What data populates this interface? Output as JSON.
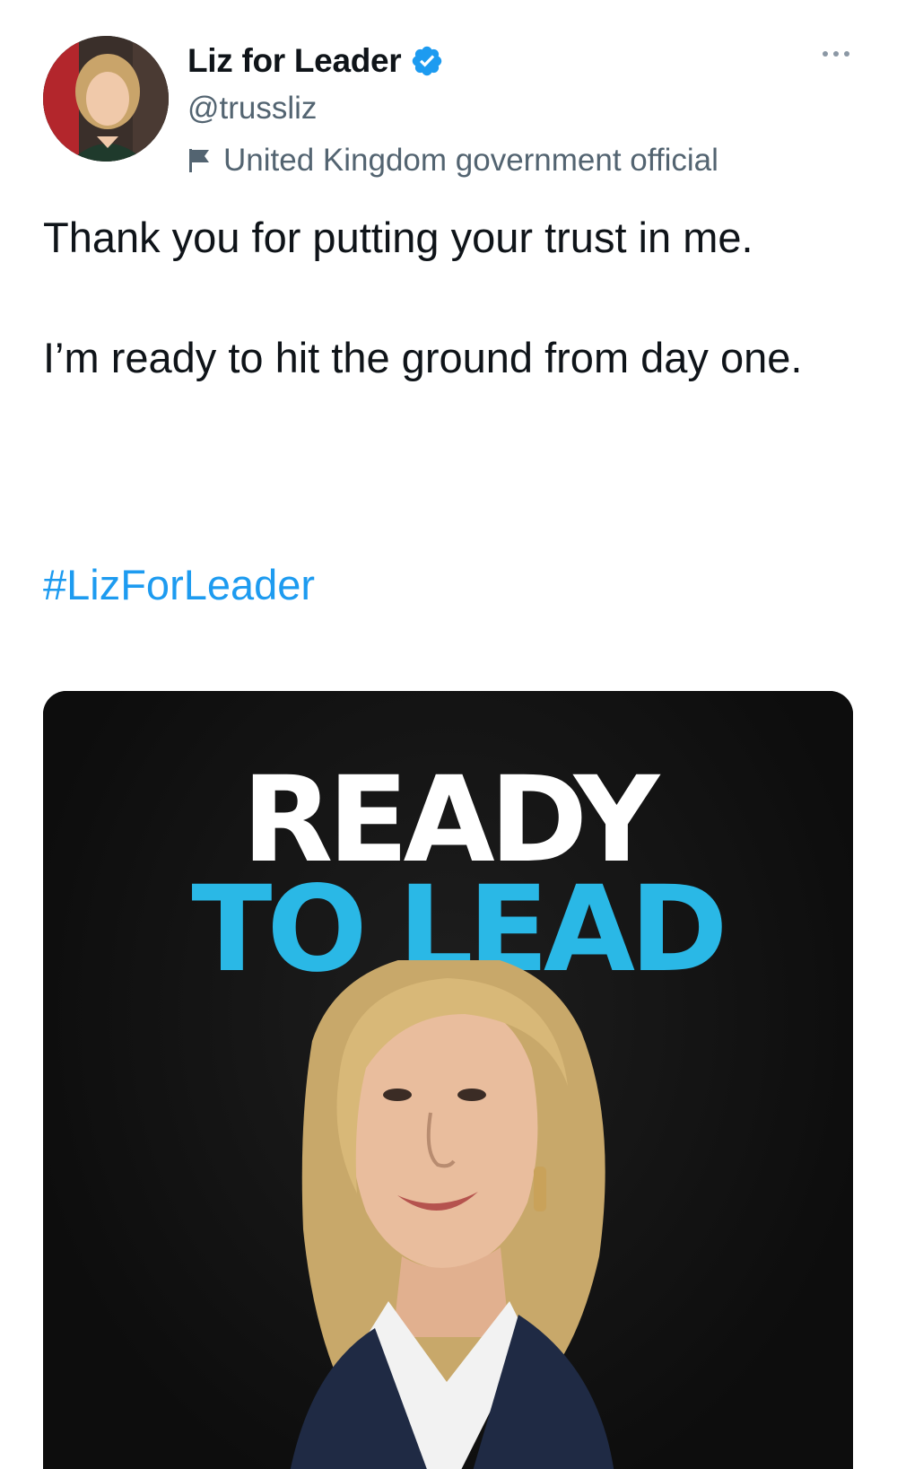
{
  "tweet": {
    "author": {
      "display_name": "Liz for Leader",
      "handle": "@trussliz",
      "affiliation_label": "United Kingdom government official",
      "verified": true
    },
    "icons": {
      "verified": "verified-badge-icon",
      "affiliation": "flag-icon",
      "more": "more-options-icon"
    },
    "text": {
      "paragraph_1": "Thank you for putting your trust in me.",
      "paragraph_2": "I’m ready to hit the ground from day one."
    },
    "hashtag": "#LizForLeader",
    "media": {
      "headline_line_1": "READY",
      "headline_line_2": "TO LEAD"
    }
  },
  "colors": {
    "link": "#1d9bf0",
    "secondary_text": "#536471",
    "primary_text": "#0f1419",
    "headline_white": "#ffffff",
    "headline_blue": "#2ab8e6",
    "media_background": "#111111"
  }
}
